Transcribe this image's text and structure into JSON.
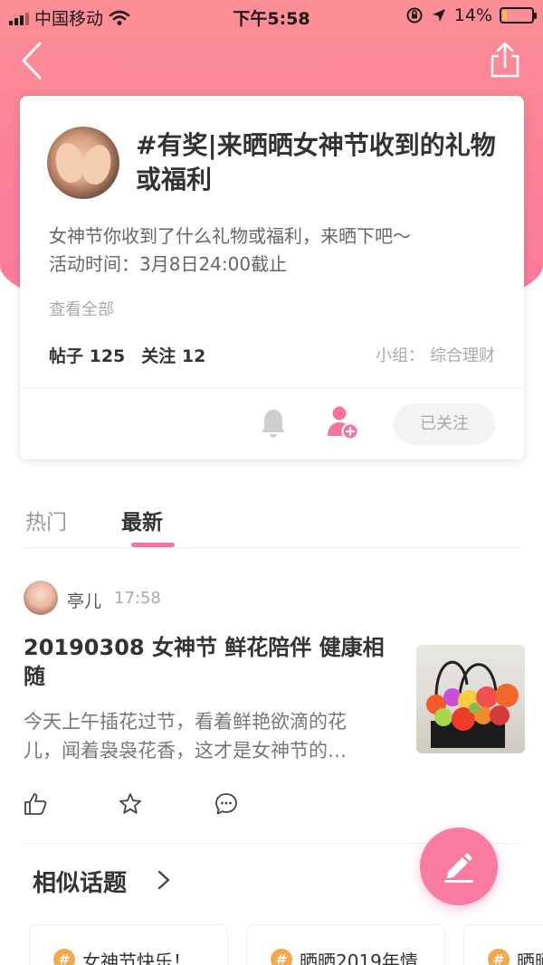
{
  "status_bar": {
    "carrier": "中国移动",
    "time": "下午5:58",
    "battery": "14%",
    "battery_level": 0.14
  },
  "topic": {
    "title": "#有奖|来晒晒女神节收到的礼物或福利",
    "description_lines": [
      "女神节你收到了什么礼物或福利，来晒下吧～",
      "活动时间：3月8日24:00截止"
    ],
    "see_all": "查看全部",
    "posts_label": "帖子 125",
    "followers_label": "关注 12",
    "group_prefix": "小组：",
    "group_name": "综合理财",
    "follow_button": "已关注"
  },
  "tabs": [
    {
      "label": "热门",
      "active": false
    },
    {
      "label": "最新",
      "active": true
    }
  ],
  "post": {
    "author": "亭儿",
    "time": "17:58",
    "title": "20190308 女神节 鲜花陪伴 健康相随",
    "excerpt_lines": [
      "今天上午插花过节，看着鲜艳欲滴的花",
      "儿，闻着袅袅花香，这才是女神节的…"
    ]
  },
  "similar": {
    "title": "相似话题",
    "cards": [
      {
        "label": "女神节快乐！"
      },
      {
        "label": "晒晒2019年情"
      },
      {
        "label": "晒晒"
      }
    ]
  },
  "colors": {
    "header_pink": "#fc8e95",
    "accent_pink": "#f6739a",
    "fab_pink": "#f97ba1",
    "hash_orange": "#f5a84a"
  }
}
